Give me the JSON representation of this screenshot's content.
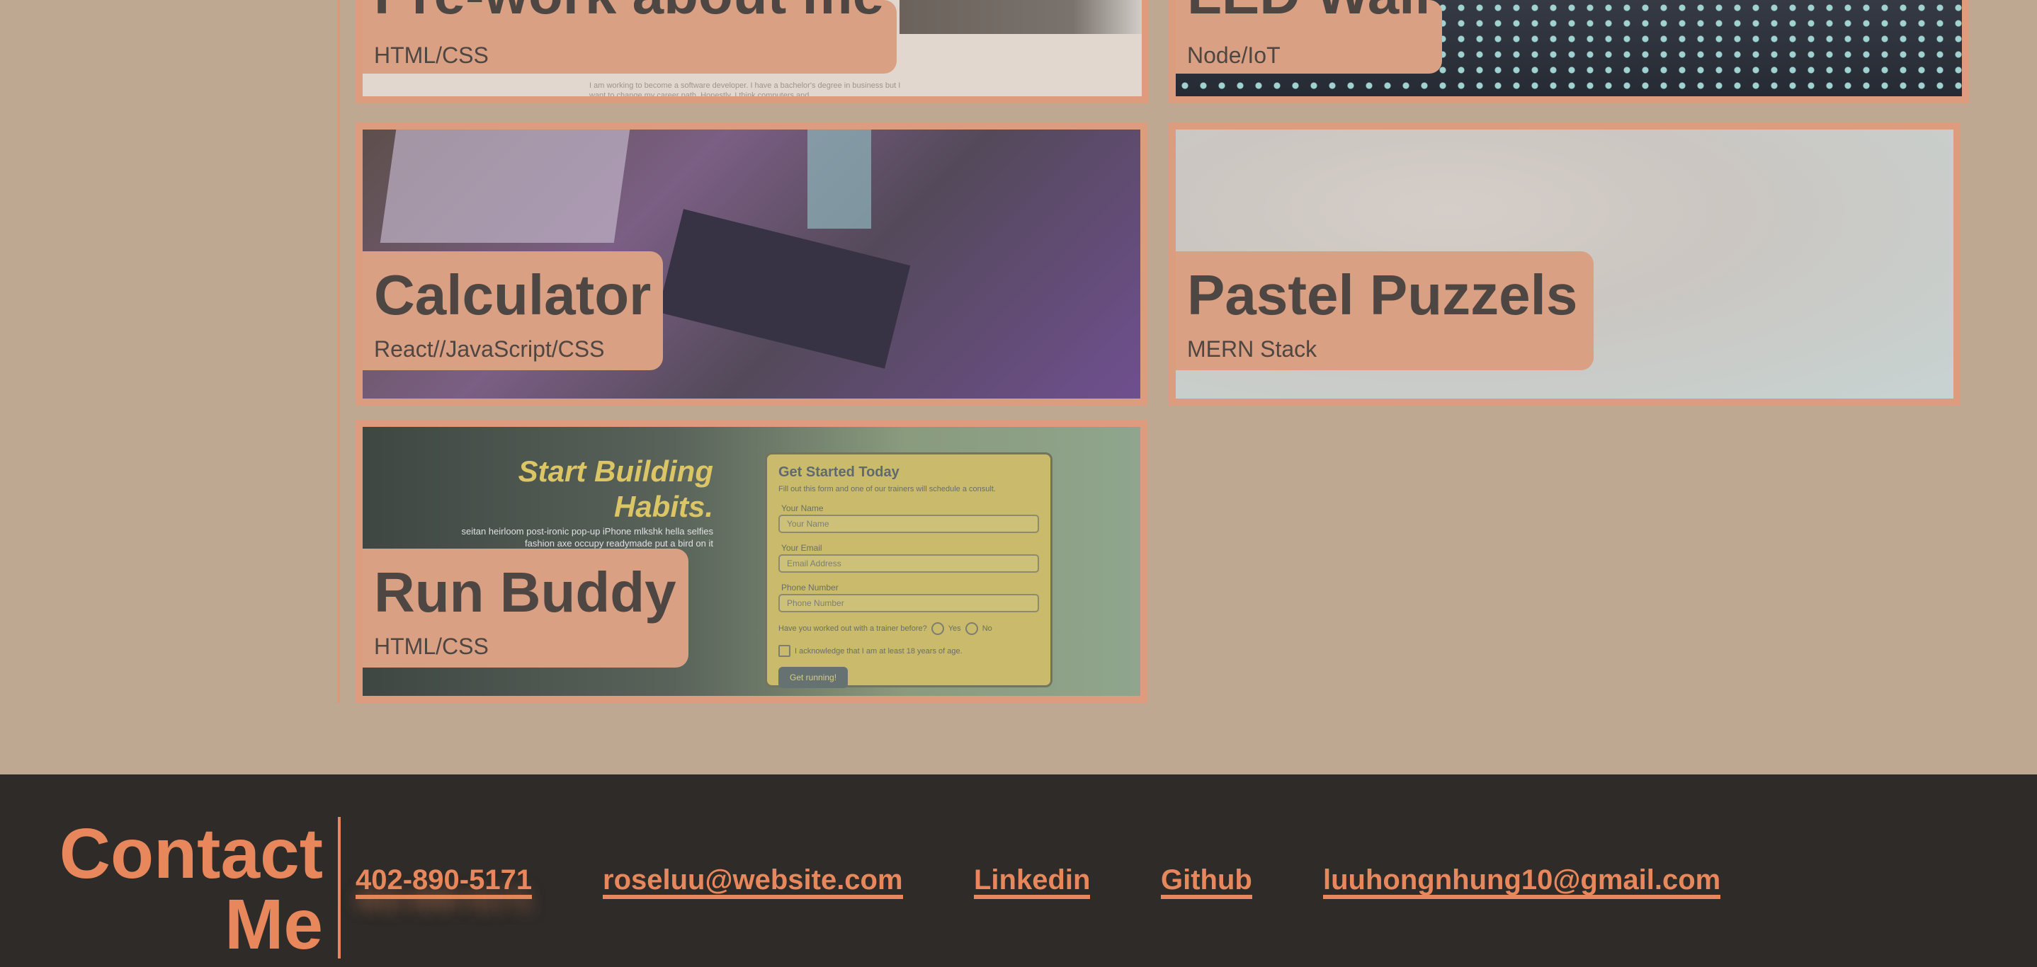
{
  "projects": [
    {
      "title": "Pre-work about me",
      "tech": "HTML/CSS",
      "snippet": "I am working to become a software developer. I have a bachelor's degree in business but I want to change my career path. Honestly, I think computers and"
    },
    {
      "title": "LED Wall",
      "tech": "Node/IoT"
    },
    {
      "title": "Calculator",
      "tech": "React//JavaScript/CSS"
    },
    {
      "title": "Pastel Puzzels",
      "tech": "MERN Stack"
    },
    {
      "title": "Run Buddy",
      "tech": "HTML/CSS"
    }
  ],
  "run_buddy_preview": {
    "hero": "Start Building Habits.",
    "lorem": "seitan heirloom post-ironic pop-up iPhone mlkshk hella selfies fashion axe occupy readymade put a bird on it",
    "form_title": "Get Started Today",
    "form_sub": "Fill out this form and one of our trainers will schedule a consult.",
    "name_label": "Your Name",
    "name_placeholder": "Your Name",
    "email_label": "Your Email",
    "email_placeholder": "Email Address",
    "phone_label": "Phone Number",
    "phone_placeholder": "Phone Number",
    "question": "Have you worked out with a trainer before?",
    "yes": "Yes",
    "no": "No",
    "ack": "I acknowledge that I am at least 18 years of age.",
    "button": "Get running!"
  },
  "footer": {
    "title_line1": "Contact",
    "title_line2": "Me",
    "links": [
      "402-890-5171",
      "roseluu@website.com",
      "Linkedin",
      "Github",
      "luuhongnhung10@gmail.com"
    ]
  },
  "colors": {
    "background": "#bea892",
    "accent": "#e8875b",
    "footer": "#2e2b28",
    "card_border": "#dc9c7d"
  }
}
